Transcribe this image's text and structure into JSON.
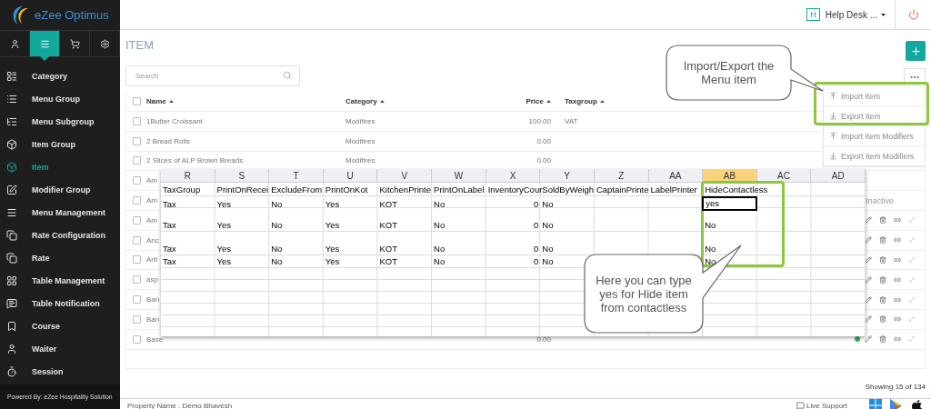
{
  "app": {
    "logo": "eZee Optimus"
  },
  "sidebar": {
    "tabs": [
      {
        "selected": false
      },
      {
        "selected": true
      },
      {
        "selected": false
      },
      {
        "selected": false
      }
    ],
    "items": [
      {
        "label": "Category",
        "selected": false
      },
      {
        "label": "Menu Group",
        "selected": false
      },
      {
        "label": "Menu Subgroup",
        "selected": false
      },
      {
        "label": "Item Group",
        "selected": false
      },
      {
        "label": "Item",
        "selected": true
      },
      {
        "label": "Modifier Group",
        "selected": false
      },
      {
        "label": "Menu Management",
        "selected": false
      },
      {
        "label": "Rate Configuration",
        "selected": false
      },
      {
        "label": "Rate",
        "selected": false
      },
      {
        "label": "Table Management",
        "selected": false
      },
      {
        "label": "Table Notification",
        "selected": false
      },
      {
        "label": "Course",
        "selected": false
      },
      {
        "label": "Waiter",
        "selected": false
      },
      {
        "label": "Session",
        "selected": false
      }
    ],
    "footer": "Powered By: eZee Hospitality Solution"
  },
  "topbar": {
    "badge": "H",
    "user": "Help Desk ..."
  },
  "page": {
    "title": "ITEM"
  },
  "search": {
    "placeholder": "Search"
  },
  "dropdown": [
    {
      "label": "Import Item",
      "kind": "import"
    },
    {
      "label": "Export Item",
      "kind": "export"
    },
    {
      "label": "Import Item Modifiers",
      "kind": "import"
    },
    {
      "label": "Export Item Modifiers",
      "kind": "export"
    }
  ],
  "table": {
    "select_all": {
      "checked": false
    },
    "columns": [
      "Name",
      "Category",
      "Price",
      "Taxgroup"
    ],
    "rows": [
      {
        "name": "1Butter Croissant",
        "category": "Modifires",
        "price": "100.00",
        "taxgroup": "VAT",
        "checked": false,
        "active": false,
        "actions": false
      },
      {
        "name": "2 Bread Rolls",
        "category": "Modifires",
        "price": "0.00",
        "checked": false,
        "active": false,
        "actions": false
      },
      {
        "name": "2 Slices of ALP Brown Breads",
        "category": "Modifires",
        "price": "0.00",
        "checked": false,
        "active": false,
        "actions": false
      },
      {
        "name": "Am",
        "checked": false,
        "active": false,
        "actions": false
      },
      {
        "name": "Am",
        "status": "Inactive",
        "checked": false,
        "active": false,
        "actions": false
      },
      {
        "name": "Am",
        "checked": false,
        "active": false,
        "actions": true
      },
      {
        "name": "Anc",
        "checked": false,
        "active": false,
        "actions": true
      },
      {
        "name": "Arti",
        "checked": false,
        "active": false,
        "actions": true
      },
      {
        "name": "asp",
        "checked": false,
        "active": false,
        "actions": true
      },
      {
        "name": "Ban",
        "checked": false,
        "active": false,
        "actions": true
      },
      {
        "name": "Ban",
        "checked": false,
        "active": false,
        "actions": true
      },
      {
        "name": "Base",
        "price": "0.00",
        "checked": false,
        "active": true,
        "actions": true
      }
    ],
    "footer": "Showing 15 of 134"
  },
  "sheet": {
    "columns": [
      {
        "label": "R",
        "selected": false
      },
      {
        "label": "S",
        "selected": false
      },
      {
        "label": "T",
        "selected": false
      },
      {
        "label": "U",
        "selected": false
      },
      {
        "label": "V",
        "selected": false
      },
      {
        "label": "W",
        "selected": false
      },
      {
        "label": "X",
        "selected": false
      },
      {
        "label": "Y",
        "selected": false
      },
      {
        "label": "Z",
        "selected": false
      },
      {
        "label": "AA",
        "selected": false
      },
      {
        "label": "AB",
        "selected": true
      },
      {
        "label": "AC",
        "selected": false
      },
      {
        "label": "AD",
        "selected": false
      }
    ],
    "rows": [
      {
        "cells": [
          {
            "text": "TaxGroup",
            "kind": "text",
            "selected": false
          },
          {
            "text": "PrintOnRecei",
            "kind": "text",
            "selected": false
          },
          {
            "text": "ExcludeFrom",
            "kind": "text",
            "selected": false
          },
          {
            "text": "PrintOnKot",
            "kind": "text",
            "selected": false
          },
          {
            "text": "KitchenPrinte",
            "kind": "text",
            "selected": false
          },
          {
            "text": "PrintOnLabel",
            "kind": "text",
            "selected": false
          },
          {
            "text": "InventoryCour",
            "kind": "text",
            "selected": false
          },
          {
            "text": "SoldByWeigh",
            "kind": "text",
            "selected": false
          },
          {
            "text": "CaptainPrinte",
            "kind": "text",
            "selected": false
          },
          {
            "text": "LabelPrinter",
            "kind": "text",
            "selected": false
          },
          {
            "text": "HideContactless",
            "kind": "text",
            "selected": false
          },
          null,
          null
        ]
      },
      {
        "cells": [
          {
            "text": "Tax",
            "kind": "text",
            "selected": false
          },
          {
            "text": "Yes",
            "kind": "text",
            "selected": false
          },
          {
            "text": "No",
            "kind": "text",
            "selected": false
          },
          {
            "text": "Yes",
            "kind": "text",
            "selected": false
          },
          {
            "text": "KOT",
            "kind": "text",
            "selected": false
          },
          {
            "text": "No",
            "kind": "text",
            "selected": false
          },
          {
            "text": "0",
            "kind": "number",
            "selected": false
          },
          {
            "text": "No",
            "kind": "text",
            "selected": false
          },
          null,
          null,
          {
            "text": "yes",
            "kind": "text",
            "selected": true
          },
          null,
          null
        ]
      },
      {
        "cells": [
          {
            "text": "Tax",
            "kind": "text",
            "selected": false
          },
          {
            "text": "Yes",
            "kind": "text",
            "selected": false
          },
          {
            "text": "No",
            "kind": "text",
            "selected": false
          },
          {
            "text": "Yes",
            "kind": "text",
            "selected": false
          },
          {
            "text": "KOT",
            "kind": "text",
            "selected": false
          },
          {
            "text": "No",
            "kind": "text",
            "selected": false
          },
          {
            "text": "0",
            "kind": "number",
            "selected": false
          },
          {
            "text": "No",
            "kind": "text",
            "selected": false
          },
          null,
          null,
          {
            "text": "No",
            "kind": "text",
            "selected": false
          },
          null,
          null
        ]
      },
      {
        "cells": [
          {
            "text": "Tax",
            "kind": "text",
            "selected": false
          },
          {
            "text": "Yes",
            "kind": "text",
            "selected": false
          },
          {
            "text": "No",
            "kind": "text",
            "selected": false
          },
          {
            "text": "Yes",
            "kind": "text",
            "selected": false
          },
          {
            "text": "KOT",
            "kind": "text",
            "selected": false
          },
          {
            "text": "No",
            "kind": "text",
            "selected": false
          },
          {
            "text": "0",
            "kind": "number",
            "selected": false
          },
          {
            "text": "No",
            "kind": "text",
            "selected": false
          },
          null,
          null,
          {
            "text": "No",
            "kind": "text",
            "selected": false
          },
          null,
          null
        ]
      },
      {
        "cells": [
          {
            "text": "Tax",
            "kind": "text",
            "selected": false
          },
          {
            "text": "Yes",
            "kind": "text",
            "selected": false
          },
          {
            "text": "No",
            "kind": "text",
            "selected": false
          },
          {
            "text": "Yes",
            "kind": "text",
            "selected": false
          },
          {
            "text": "KOT",
            "kind": "text",
            "selected": false
          },
          {
            "text": "No",
            "kind": "text",
            "selected": false
          },
          {
            "text": "0",
            "kind": "number",
            "selected": false
          },
          {
            "text": "No",
            "kind": "text",
            "selected": false
          },
          null,
          null,
          {
            "text": "No",
            "kind": "text",
            "selected": false
          },
          null,
          null
        ]
      }
    ]
  },
  "callouts": [
    {
      "text": "Import/Export the Menu item"
    },
    {
      "text": "Here you can type yes for Hide item from contactless"
    }
  ],
  "footer": {
    "property": "Property Name : Demo Bhavesh",
    "support": "Live Support"
  }
}
